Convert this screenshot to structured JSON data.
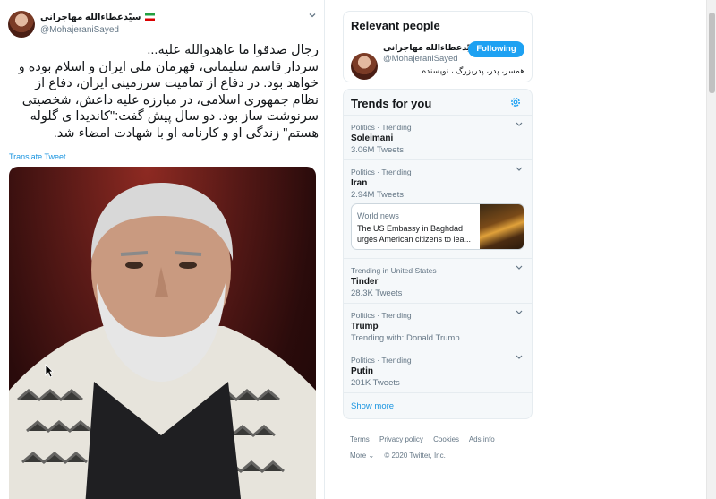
{
  "tweet": {
    "author_name": "سیّدعطاءالله مهاجرانی",
    "author_handle": "@MohajeraniSayed",
    "flag_icon": "iran-flag-icon",
    "text": "رجال صدقوا ما عاهدوالله علیه...\nسردار قاسم سلیمانی، قهرمان ملی ایران و اسلام بوده و خواهد بود. در دفاع از تمامیت  سرزمینی ایران، دفاع از نظام جمهوری اسلامی، در مبارزه علیه داعش، شخصیتی سرنوشت ساز بود. دو سال پیش گفت:\"کاندیدا ی گلوله هستم\" زندگی او و کارنامه او با شهادت امضاء شد.",
    "translate_label": "Translate Tweet"
  },
  "relevant_people": {
    "title": "Relevant people",
    "name": "سیّدعطاءالله مهاجرانی...",
    "handle": "@MohajeraniSayed",
    "follow_label": "Following",
    "bio": "همسر، پدر، پدربزرگ ، نویسنده"
  },
  "trends": {
    "title": "Trends for you",
    "items": [
      {
        "meta": "Politics · Trending",
        "name": "Soleimani",
        "count": "3.06M Tweets"
      },
      {
        "meta": "Politics · Trending",
        "name": "Iran",
        "count": "2.94M Tweets"
      },
      {
        "meta": "Trending in United States",
        "name": "Tinder",
        "count": "28.3K Tweets"
      },
      {
        "meta": "Politics · Trending",
        "name": "Trump",
        "count": "Trending with: Donald Trump"
      },
      {
        "meta": "Politics · Trending",
        "name": "Putin",
        "count": "201K Tweets"
      }
    ],
    "news": {
      "label": "World news",
      "headline": "The US Embassy in Baghdad urges American citizens to lea..."
    },
    "show_more": "Show more"
  },
  "footer": {
    "links": [
      "Terms",
      "Privacy policy",
      "Cookies",
      "Ads info"
    ],
    "more": "More ⌄",
    "copyright": "© 2020 Twitter, Inc."
  },
  "colors": {
    "accent": "#1da1f2",
    "link": "#1b95e0",
    "muted": "#657786"
  }
}
